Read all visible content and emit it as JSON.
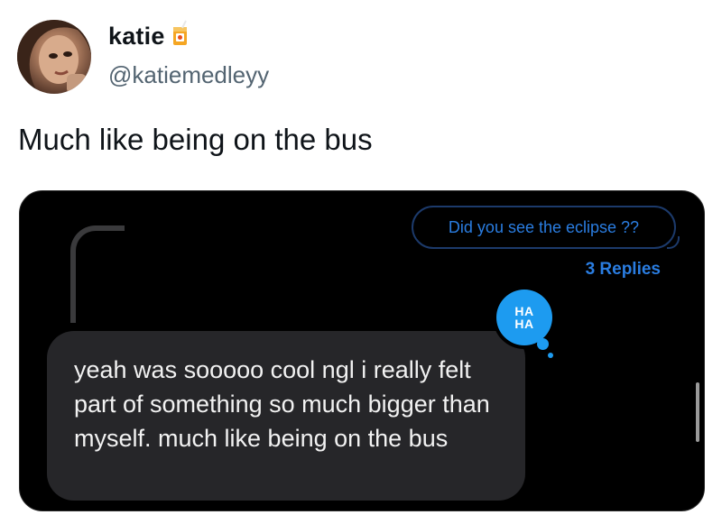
{
  "tweet": {
    "display_name": "katie",
    "name_emoji": "juice-box-emoji",
    "handle": "@katiemedleyy",
    "text": "Much like being on the bus"
  },
  "media": {
    "quoted_message": "Did you see the eclipse ??",
    "replies_label": "3 Replies",
    "reaction": {
      "line1": "HA",
      "line2": "HA"
    },
    "message_text": "yeah was sooooo cool ngl i really felt part of something so much bigger than myself. much like being on the bus"
  },
  "colors": {
    "accent_blue": "#2a7de1",
    "reaction_blue": "#1d9bf0",
    "bubble_dark": "#262629",
    "handle_gray": "#536471"
  }
}
